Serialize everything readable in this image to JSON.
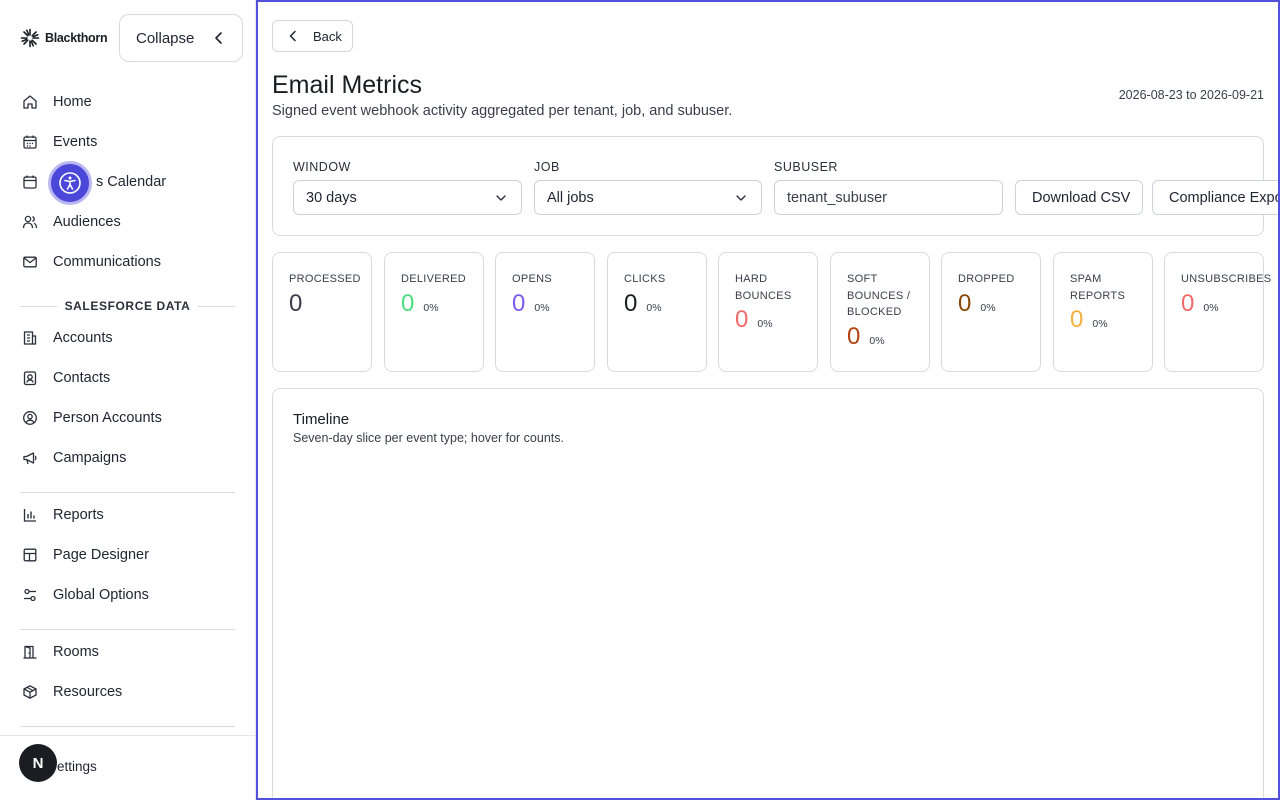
{
  "brand": {
    "name": "Blackthorn"
  },
  "sidebar": {
    "collapse_label": "Collapse",
    "items": [
      {
        "label": "Home",
        "icon": "home-icon"
      },
      {
        "label": "Events",
        "icon": "calendar-icon"
      },
      {
        "label": "Events Calendar",
        "visible_label": "s Calendar",
        "icon": "calendar-icon"
      },
      {
        "label": "Audiences",
        "icon": "users-icon"
      },
      {
        "label": "Communications",
        "icon": "mail-icon"
      }
    ],
    "section_label": "SALESFORCE DATA",
    "salesforce_items": [
      {
        "label": "Accounts",
        "icon": "building-icon"
      },
      {
        "label": "Contacts",
        "icon": "contact-icon"
      },
      {
        "label": "Person Accounts",
        "icon": "user-circle-icon"
      },
      {
        "label": "Campaigns",
        "icon": "megaphone-icon"
      }
    ],
    "tools_items": [
      {
        "label": "Reports",
        "icon": "bar-chart-icon"
      },
      {
        "label": "Page Designer",
        "icon": "layout-icon"
      },
      {
        "label": "Global Options",
        "icon": "sliders-icon"
      }
    ],
    "venue_items": [
      {
        "label": "Rooms",
        "icon": "door-icon"
      },
      {
        "label": "Resources",
        "icon": "box-icon"
      }
    ],
    "settings_label": "ettings",
    "avatar_initial": "N"
  },
  "main": {
    "back_label": "Back",
    "title": "Email Metrics",
    "subtitle": "Signed event webhook activity aggregated per tenant, job, and subuser.",
    "date_range": "2026-08-23 to 2026-09-21",
    "filters": {
      "window_label": "WINDOW",
      "window_value": "30 days",
      "job_label": "JOB",
      "job_value": "All jobs",
      "subuser_label": "SUBUSER",
      "subuser_value": "tenant_subuser",
      "download_label": "Download CSV",
      "compliance_label": "Compliance Export"
    },
    "metrics": [
      {
        "label": "PROCESSED",
        "value": "0",
        "pct": "",
        "color": "#3a3e4a"
      },
      {
        "label": "DELIVERED",
        "value": "0",
        "pct": "0%",
        "color": "#4ade80"
      },
      {
        "label": "OPENS",
        "value": "0",
        "pct": "0%",
        "color": "#7c5cf0"
      },
      {
        "label": "CLICKS",
        "value": "0",
        "pct": "0%",
        "color": "#1a1c22"
      },
      {
        "label": "HARD BOUNCES",
        "value": "0",
        "pct": "0%",
        "color": "#f06a6a"
      },
      {
        "label": "SOFT BOUNCES / BLOCKED",
        "value": "0",
        "pct": "0%",
        "color": "#b3420f"
      },
      {
        "label": "DROPPED",
        "value": "0",
        "pct": "0%",
        "color": "#8a4a07"
      },
      {
        "label": "SPAM REPORTS",
        "value": "0",
        "pct": "0%",
        "color": "#f5b040"
      },
      {
        "label": "UNSUBSCRIBES",
        "value": "0",
        "pct": "0%",
        "color": "#f06a6a"
      }
    ],
    "timeline": {
      "title": "Timeline",
      "subtitle": "Seven-day slice per event type; hover for counts."
    }
  },
  "colors": {
    "accent": "#5250dc",
    "a11y": "#4b47d9"
  }
}
